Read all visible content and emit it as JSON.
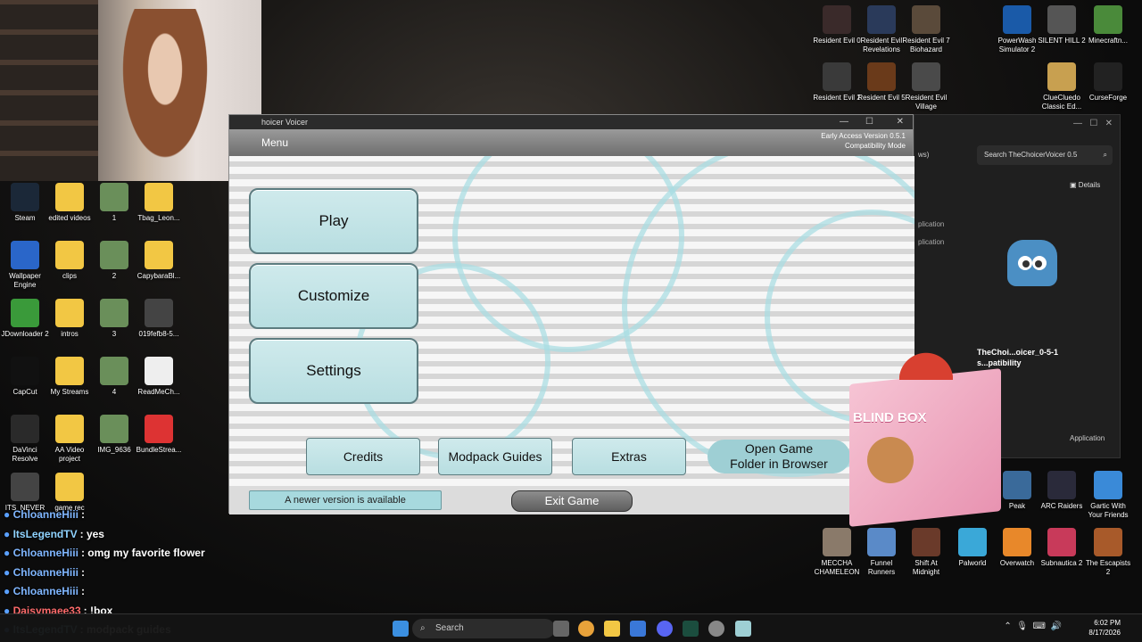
{
  "game_window": {
    "title": "hoicer Voicer",
    "menu_label": "Menu",
    "version": "Early Access Version 0.5.1",
    "mode": "Compatibility Mode",
    "buttons": {
      "play": "Play",
      "customize": "Customize",
      "settings": "Settings",
      "credits": "Credits",
      "modpack_guides": "Modpack Guides",
      "extras": "Extras",
      "open_game_folder_line1": "Open Game",
      "open_game_folder_line2": "Folder in Browser",
      "newer_version": "A newer version is available",
      "exit_game": "Exit Game"
    },
    "colors": {
      "accent": "#a7dde2",
      "button": "#c4e5e8"
    }
  },
  "explorer_window": {
    "partial_label": "ws)",
    "search_placeholder": "Search TheChoicerVoicer 0.5",
    "details_label": "Details",
    "file_name_line1": "TheChoi...oicer_0-5-1",
    "file_name_line2": "s...patibility",
    "file_type": "Application",
    "side_labels": [
      "plication",
      "plication"
    ]
  },
  "blind_box": {
    "label": "BLIND BOX"
  },
  "desktop_left": [
    {
      "label": "Steam",
      "icon": "steam-icon"
    },
    {
      "label": "edited videos",
      "icon": "folder-icon"
    },
    {
      "label": "1",
      "icon": "image-icon"
    },
    {
      "label": "Tbag_Leon...",
      "icon": "folder-icon"
    },
    {
      "label": "Wallpaper Engine",
      "icon": "wallpaper-engine-icon"
    },
    {
      "label": "clips",
      "icon": "folder-icon"
    },
    {
      "label": "2",
      "icon": "image-icon"
    },
    {
      "label": "CapybaraBl...",
      "icon": "folder-icon"
    },
    {
      "label": "JDownloader 2",
      "icon": "jdownloader-icon"
    },
    {
      "label": "intros",
      "icon": "folder-icon"
    },
    {
      "label": "3",
      "icon": "image-icon"
    },
    {
      "label": "019fefb8-5...",
      "icon": "video-icon"
    },
    {
      "label": "CapCut",
      "icon": "capcut-icon"
    },
    {
      "label": "My Streams",
      "icon": "folder-icon"
    },
    {
      "label": "4",
      "icon": "image-icon"
    },
    {
      "label": "ReadMeCh...",
      "icon": "document-icon"
    },
    {
      "label": "DaVinci Resolve",
      "icon": "davinci-icon"
    },
    {
      "label": "AA Video project",
      "icon": "folder-icon"
    },
    {
      "label": "IMG_9636",
      "icon": "image-icon"
    },
    {
      "label": "BundleStrea...",
      "icon": "pdf-icon"
    },
    {
      "label": "ITS_NEVER",
      "icon": "video-icon"
    },
    {
      "label": "game rec",
      "icon": "folder-icon"
    }
  ],
  "desktop_right_top": [
    {
      "label": "Resident Evil 0"
    },
    {
      "label": "Resident Evil Revelations"
    },
    {
      "label": "Resident Evil 7 Biohazard"
    },
    {
      "label": "PowerWash Simulator 2"
    },
    {
      "label": "SILENT HILL 2"
    },
    {
      "label": "Minecraftn..."
    },
    {
      "label": "Resident Evil 2"
    },
    {
      "label": "Resident Evil 5"
    },
    {
      "label": "Resident Evil Village"
    },
    {
      "label": "ClueCluedo Classic Ed..."
    },
    {
      "label": "CurseForge"
    }
  ],
  "desktop_right_bottom": [
    {
      "label": "MECCHA CHAMELEON"
    },
    {
      "label": "Funnel Runners"
    },
    {
      "label": "Shift At Midnight"
    },
    {
      "label": "Palworld"
    },
    {
      "label": "Overwatch"
    },
    {
      "label": "Subnautica 2"
    },
    {
      "label": "The Escapists 2"
    },
    {
      "label": "Peak"
    },
    {
      "label": "ARC Raiders"
    },
    {
      "label": "Gartic With Your Friends"
    }
  ],
  "chat": [
    {
      "user": "ChloanneHiii",
      "msg": ":",
      "color": "#7fb6ff"
    },
    {
      "user": "ItsLegendTV",
      "msg": ": yes",
      "color": "#8fd3ff"
    },
    {
      "user": "ChloanneHiii",
      "msg": ": omg my favorite flower",
      "color": "#7fb6ff"
    },
    {
      "user": "ChloanneHiii",
      "msg": ":",
      "color": "#7fb6ff"
    },
    {
      "user": "ChloanneHiii",
      "msg": ":",
      "color": "#7fb6ff"
    },
    {
      "user": "Daisymaee33",
      "msg": ": !box",
      "color": "#ff6b6b"
    },
    {
      "user": "ItsLegendTV",
      "msg": ": modpack guides",
      "color": "#8fd3ff"
    }
  ],
  "taskbar": {
    "search_placeholder": "Search",
    "time": "6:02 PM",
    "date": "8/17/2026"
  }
}
